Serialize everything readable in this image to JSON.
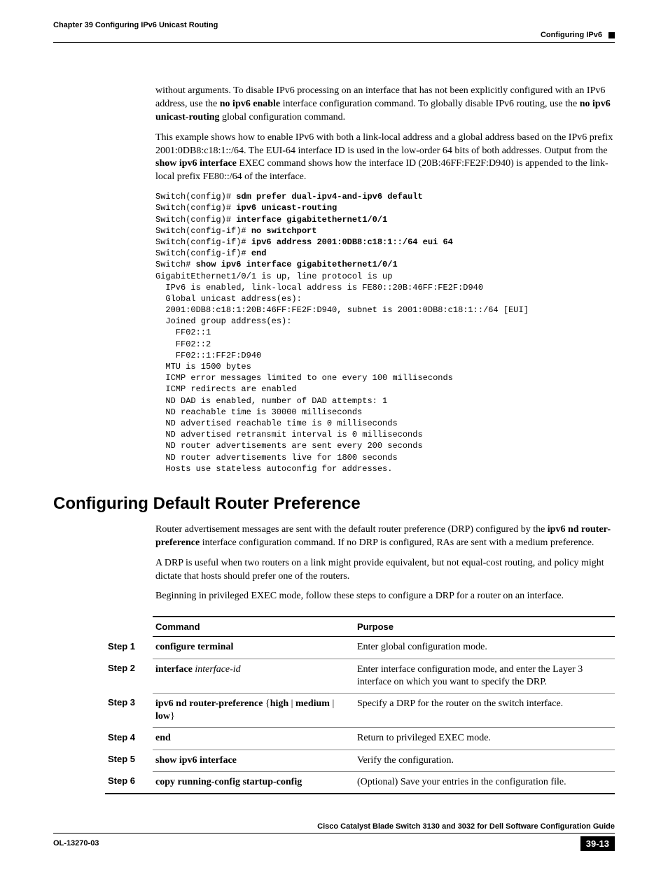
{
  "header": {
    "chapter": "Chapter 39      Configuring IPv6 Unicast Routing",
    "section": "Configuring IPv6"
  },
  "intro": {
    "p1_a": "without arguments. To disable IPv6 processing on an interface that has not been explicitly configured with an IPv6 address, use the ",
    "p1_b": "no ipv6 enable",
    "p1_c": " interface configuration command. To globally disable IPv6 routing, use the ",
    "p1_d": "no ipv6 unicast-routing",
    "p1_e": " global configuration command.",
    "p2_a": "This example shows how to enable IPv6 with both a link-local address and a global address based on the IPv6 prefix 2001:0DB8:c18:1::/64. The EUI-64 interface ID is used in the low-order 64 bits of both addresses. Output from the ",
    "p2_b": "show ipv6 interface",
    "p2_c": " EXEC command shows how the interface ID (20B:46FF:FE2F:D940) is appended to the link-local prefix FE80::/64 of the interface."
  },
  "code": {
    "l1p": "Switch(config)# ",
    "l1b": "sdm prefer dual-ipv4-and-ipv6 default",
    "l2p": "Switch(config)# ",
    "l2b": "ipv6 unicast-routing",
    "l3p": "Switch(config)# ",
    "l3b": "interface gigabitethernet1/0/1",
    "l4p": "Switch(config-if)# ",
    "l4b": "no switchport",
    "l5p": "Switch(config-if)# ",
    "l5b": "ipv6 address 2001:0DB8:c18:1::/64 eui 64",
    "l6p": "Switch(config-if)# ",
    "l6b": "end",
    "l7p": "Switch# ",
    "l7b": "show ipv6 interface gigabitethernet1/0/1",
    "out": "GigabitEthernet1/0/1 is up, line protocol is up\n  IPv6 is enabled, link-local address is FE80::20B:46FF:FE2F:D940\n  Global unicast address(es):\n  2001:0DB8:c18:1:20B:46FF:FE2F:D940, subnet is 2001:0DB8:c18:1::/64 [EUI]\n  Joined group address(es):\n    FF02::1\n    FF02::2\n    FF02::1:FF2F:D940\n  MTU is 1500 bytes\n  ICMP error messages limited to one every 100 milliseconds\n  ICMP redirects are enabled\n  ND DAD is enabled, number of DAD attempts: 1\n  ND reachable time is 30000 milliseconds\n  ND advertised reachable time is 0 milliseconds\n  ND advertised retransmit interval is 0 milliseconds\n  ND router advertisements are sent every 200 seconds\n  ND router advertisements live for 1800 seconds\n  Hosts use stateless autoconfig for addresses."
  },
  "section2": {
    "title": "Configuring Default Router Preference",
    "p1_a": "Router advertisement messages are sent with the default router preference (DRP) configured by the ",
    "p1_b": "ipv6 nd router-preference",
    "p1_c": " interface configuration command. If no DRP is configured, RAs are sent with a medium preference.",
    "p2": "A DRP is useful when two routers on a link might provide equivalent, but not equal-cost routing, and policy might dictate that hosts should prefer one of the routers.",
    "p3": "Beginning in privileged EXEC mode, follow these steps to configure a DRP for a router on an interface."
  },
  "table": {
    "head_cmd": "Command",
    "head_purpose": "Purpose",
    "rows": [
      {
        "step": "Step 1",
        "cmd_b1": "configure terminal",
        "purpose": "Enter global configuration mode."
      },
      {
        "step": "Step 2",
        "cmd_b1": "interface",
        "cmd_i1": " interface-id",
        "purpose": "Enter interface configuration mode, and enter the Layer 3 interface on which you want to specify the DRP."
      },
      {
        "step": "Step 3",
        "cmd_b1": "ipv6 nd router-preference",
        "cmd_t1": " {",
        "cmd_b2": "high",
        "cmd_t2": " | ",
        "cmd_b3": "medium",
        "cmd_t3": " | ",
        "cmd_b4": "low",
        "cmd_t4": "}",
        "purpose": "Specify a DRP for the router on the switch interface."
      },
      {
        "step": "Step 4",
        "cmd_b1": "end",
        "purpose": "Return to privileged EXEC mode."
      },
      {
        "step": "Step 5",
        "cmd_b1": "show ipv6 interface",
        "purpose": "Verify the configuration."
      },
      {
        "step": "Step 6",
        "cmd_b1": "copy running-config startup-config",
        "purpose": "(Optional) Save your entries in the configuration file."
      }
    ]
  },
  "footer": {
    "guide": "Cisco Catalyst Blade Switch 3130 and 3032 for Dell Software Configuration Guide",
    "docid": "OL-13270-03",
    "pagenum": "39-13"
  }
}
